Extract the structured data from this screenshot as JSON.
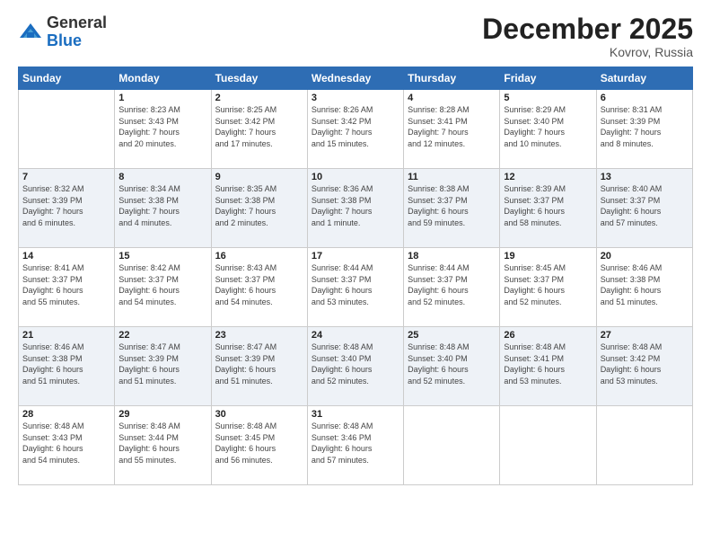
{
  "logo": {
    "general": "General",
    "blue": "Blue"
  },
  "header": {
    "month": "December 2025",
    "location": "Kovrov, Russia"
  },
  "weekdays": [
    "Sunday",
    "Monday",
    "Tuesday",
    "Wednesday",
    "Thursday",
    "Friday",
    "Saturday"
  ],
  "weeks": [
    [
      {
        "day": "",
        "info": ""
      },
      {
        "day": "1",
        "info": "Sunrise: 8:23 AM\nSunset: 3:43 PM\nDaylight: 7 hours\nand 20 minutes."
      },
      {
        "day": "2",
        "info": "Sunrise: 8:25 AM\nSunset: 3:42 PM\nDaylight: 7 hours\nand 17 minutes."
      },
      {
        "day": "3",
        "info": "Sunrise: 8:26 AM\nSunset: 3:42 PM\nDaylight: 7 hours\nand 15 minutes."
      },
      {
        "day": "4",
        "info": "Sunrise: 8:28 AM\nSunset: 3:41 PM\nDaylight: 7 hours\nand 12 minutes."
      },
      {
        "day": "5",
        "info": "Sunrise: 8:29 AM\nSunset: 3:40 PM\nDaylight: 7 hours\nand 10 minutes."
      },
      {
        "day": "6",
        "info": "Sunrise: 8:31 AM\nSunset: 3:39 PM\nDaylight: 7 hours\nand 8 minutes."
      }
    ],
    [
      {
        "day": "7",
        "info": "Sunrise: 8:32 AM\nSunset: 3:39 PM\nDaylight: 7 hours\nand 6 minutes."
      },
      {
        "day": "8",
        "info": "Sunrise: 8:34 AM\nSunset: 3:38 PM\nDaylight: 7 hours\nand 4 minutes."
      },
      {
        "day": "9",
        "info": "Sunrise: 8:35 AM\nSunset: 3:38 PM\nDaylight: 7 hours\nand 2 minutes."
      },
      {
        "day": "10",
        "info": "Sunrise: 8:36 AM\nSunset: 3:38 PM\nDaylight: 7 hours\nand 1 minute."
      },
      {
        "day": "11",
        "info": "Sunrise: 8:38 AM\nSunset: 3:37 PM\nDaylight: 6 hours\nand 59 minutes."
      },
      {
        "day": "12",
        "info": "Sunrise: 8:39 AM\nSunset: 3:37 PM\nDaylight: 6 hours\nand 58 minutes."
      },
      {
        "day": "13",
        "info": "Sunrise: 8:40 AM\nSunset: 3:37 PM\nDaylight: 6 hours\nand 57 minutes."
      }
    ],
    [
      {
        "day": "14",
        "info": "Sunrise: 8:41 AM\nSunset: 3:37 PM\nDaylight: 6 hours\nand 55 minutes."
      },
      {
        "day": "15",
        "info": "Sunrise: 8:42 AM\nSunset: 3:37 PM\nDaylight: 6 hours\nand 54 minutes."
      },
      {
        "day": "16",
        "info": "Sunrise: 8:43 AM\nSunset: 3:37 PM\nDaylight: 6 hours\nand 54 minutes."
      },
      {
        "day": "17",
        "info": "Sunrise: 8:44 AM\nSunset: 3:37 PM\nDaylight: 6 hours\nand 53 minutes."
      },
      {
        "day": "18",
        "info": "Sunrise: 8:44 AM\nSunset: 3:37 PM\nDaylight: 6 hours\nand 52 minutes."
      },
      {
        "day": "19",
        "info": "Sunrise: 8:45 AM\nSunset: 3:37 PM\nDaylight: 6 hours\nand 52 minutes."
      },
      {
        "day": "20",
        "info": "Sunrise: 8:46 AM\nSunset: 3:38 PM\nDaylight: 6 hours\nand 51 minutes."
      }
    ],
    [
      {
        "day": "21",
        "info": "Sunrise: 8:46 AM\nSunset: 3:38 PM\nDaylight: 6 hours\nand 51 minutes."
      },
      {
        "day": "22",
        "info": "Sunrise: 8:47 AM\nSunset: 3:39 PM\nDaylight: 6 hours\nand 51 minutes."
      },
      {
        "day": "23",
        "info": "Sunrise: 8:47 AM\nSunset: 3:39 PM\nDaylight: 6 hours\nand 51 minutes."
      },
      {
        "day": "24",
        "info": "Sunrise: 8:48 AM\nSunset: 3:40 PM\nDaylight: 6 hours\nand 52 minutes."
      },
      {
        "day": "25",
        "info": "Sunrise: 8:48 AM\nSunset: 3:40 PM\nDaylight: 6 hours\nand 52 minutes."
      },
      {
        "day": "26",
        "info": "Sunrise: 8:48 AM\nSunset: 3:41 PM\nDaylight: 6 hours\nand 53 minutes."
      },
      {
        "day": "27",
        "info": "Sunrise: 8:48 AM\nSunset: 3:42 PM\nDaylight: 6 hours\nand 53 minutes."
      }
    ],
    [
      {
        "day": "28",
        "info": "Sunrise: 8:48 AM\nSunset: 3:43 PM\nDaylight: 6 hours\nand 54 minutes."
      },
      {
        "day": "29",
        "info": "Sunrise: 8:48 AM\nSunset: 3:44 PM\nDaylight: 6 hours\nand 55 minutes."
      },
      {
        "day": "30",
        "info": "Sunrise: 8:48 AM\nSunset: 3:45 PM\nDaylight: 6 hours\nand 56 minutes."
      },
      {
        "day": "31",
        "info": "Sunrise: 8:48 AM\nSunset: 3:46 PM\nDaylight: 6 hours\nand 57 minutes."
      },
      {
        "day": "",
        "info": ""
      },
      {
        "day": "",
        "info": ""
      },
      {
        "day": "",
        "info": ""
      }
    ]
  ]
}
